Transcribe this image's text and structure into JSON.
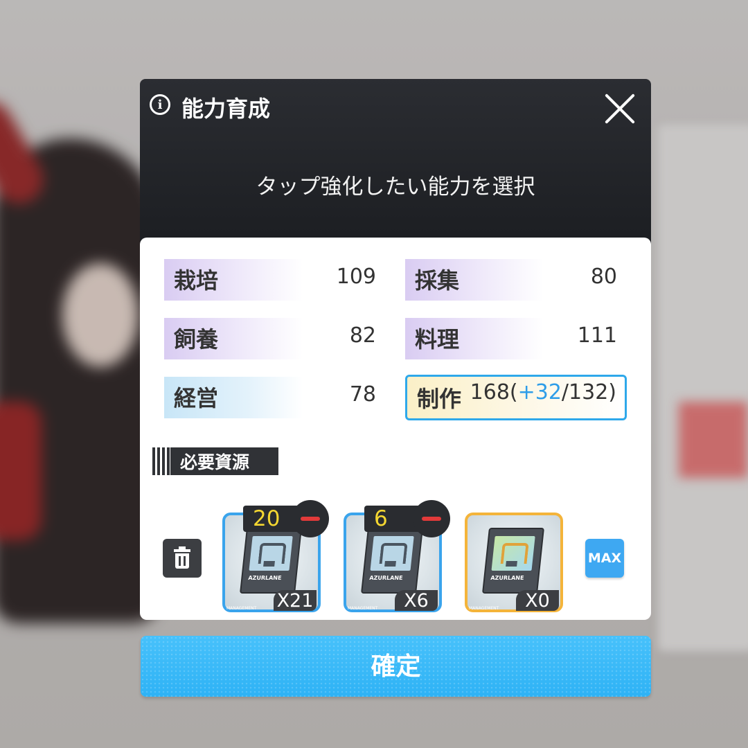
{
  "dialog": {
    "title": "能力育成",
    "subtitle": "タップ強化したい能力を選択"
  },
  "abilities": [
    {
      "name": "栽培",
      "value": "109",
      "color": "#d9ccf2"
    },
    {
      "name": "採集",
      "value": "80",
      "color": "#d9ccf2"
    },
    {
      "name": "飼養",
      "value": "82",
      "color": "#d9ccf2"
    },
    {
      "name": "料理",
      "value": "111",
      "color": "#d9ccf2"
    },
    {
      "name": "経営",
      "value": "78",
      "color": "#c8e6f7"
    },
    {
      "name": "制作",
      "value_base": "168(",
      "value_plus": "+32",
      "value_rest": "/132)",
      "selected": true
    }
  ],
  "resources": {
    "label": "必要資源",
    "items": [
      {
        "use": "20",
        "owned": "X21",
        "brand": "AZURLANE",
        "tier": "MANAGEMENT",
        "frame": "blue"
      },
      {
        "use": "6",
        "owned": "X6",
        "brand": "AZURLANE",
        "tier": "MANAGEMENT",
        "frame": "blue"
      },
      {
        "use": "",
        "owned": "X0",
        "brand": "AZURLANE",
        "tier": "MANAGEMENT",
        "frame": "orange"
      }
    ],
    "max_label": "MAX"
  },
  "confirm_label": "確定",
  "icons": [
    "info-icon",
    "close-icon",
    "trash-icon",
    "minus-icon"
  ],
  "colors": {
    "accent": "#2eb2f5",
    "selected_border": "#2ea8ea",
    "plus": "#2e9de8",
    "use_count": "#f5d731",
    "minus": "#e23a3a"
  }
}
